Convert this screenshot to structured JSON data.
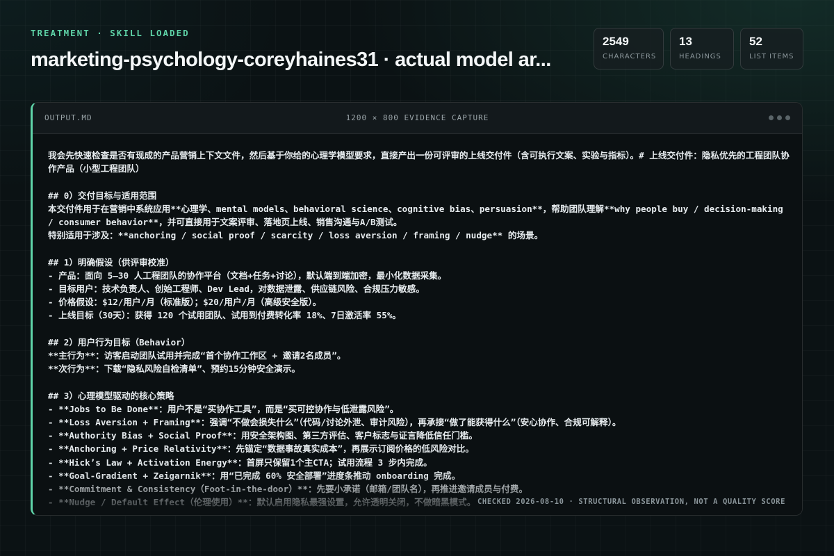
{
  "header": {
    "eyebrow": "TREATMENT · SKILL LOADED",
    "title": "marketing-psychology-coreyhaines31 · actual model ar..."
  },
  "stats": [
    {
      "value": "2549",
      "label": "CHARACTERS"
    },
    {
      "value": "13",
      "label": "HEADINGS"
    },
    {
      "value": "52",
      "label": "LIST ITEMS"
    }
  ],
  "panel": {
    "filename": "OUTPUT.MD",
    "caption": "1200 × 800 EVIDENCE CAPTURE",
    "content": "我会先快速检查是否有现成的产品营销上下文文件，然后基于你给的心理学模型要求，直接产出一份可评审的上线交付件（含可执行文案、实验与指标）。# 上线交付件：隐私优先的工程团队协作产品（小型工程团队）\n\n## 0）交付目标与适用范围\n本交付件用于在营销中系统应用**心理学、mental models、behavioral science、cognitive bias、persuasion**，帮助团队理解**why people buy / decision-making / consumer behavior**，并可直接用于文案评审、落地页上线、销售沟通与A/B测试。\n特别适用于涉及：**anchoring / social proof / scarcity / loss aversion / framing / nudge** 的场景。\n\n## 1）明确假设（供评审校准）\n- 产品：面向 5–30 人工程团队的协作平台（文档+任务+讨论），默认端到端加密，最小化数据采集。\n- 目标用户：技术负责人、创始工程师、Dev Lead，对数据泄露、供应链风险、合规压力敏感。\n- 价格假设：$12/用户/月（标准版）；$20/用户/月（高级安全版）。\n- 上线目标（30天）：获得 120 个试用团队、试用到付费转化率 18%、7日激活率 55%。\n\n## 2）用户行为目标（Behavior）\n**主行为**：访客启动团队试用并完成“首个协作工作区 + 邀请2名成员”。\n**次行为**：下载“隐私风险自检清单”、预约15分钟安全演示。\n\n## 3）心理模型驱动的核心策略\n- **Jobs to Be Done**：用户不是“买协作工具”，而是“买可控协作与低泄露风险”。\n- **Loss Aversion + Framing**：强调“不做会损失什么”（代码/讨论外泄、审计风险），再承接“做了能获得什么”（安心协作、合规可解释）。\n- **Authority Bias + Social Proof**：用安全架构图、第三方评估、客户标志与证言降低信任门槛。\n- **Anchoring + Price Relativity**：先锚定“数据事故真实成本”，再展示订阅价格的低风险对比。\n- **Hick’s Law + Activation Energy**：首屏只保留1个主CTA；试用流程 3 步内完成。\n- **Goal-Gradient + Zeigarnik**：用“已完成 60% 安全部署”进度条推动 onboarding 完成。\n- **Commitment & Consistency（Foot-in-the-door）**：先要小承诺（邮箱/团队名），再推进邀请成员与付费。\n- **Nudge / Default Effect（伦理使用）**：默认启用隐私最强设置，允许透明关闭，不做暗黑模式。",
    "footnote": "CHECKED 2026-08-10 · STRUCTURAL OBSERVATION, NOT A QUALITY SCORE"
  }
}
